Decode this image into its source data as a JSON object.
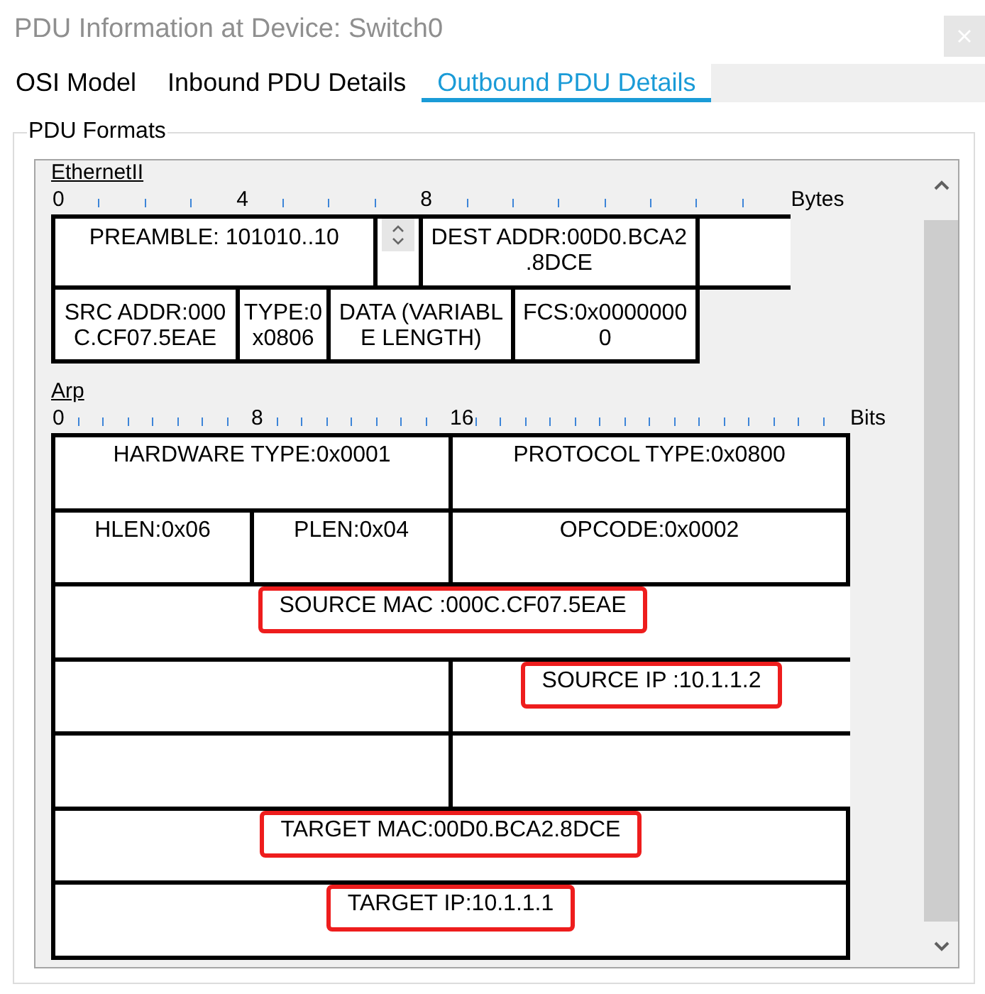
{
  "window": {
    "title": "PDU Information at Device: Switch0"
  },
  "tabs": [
    {
      "label": "OSI Model",
      "selected": false
    },
    {
      "label": "Inbound PDU Details",
      "selected": false
    },
    {
      "label": "Outbound PDU Details",
      "selected": true
    }
  ],
  "pdu_formats": {
    "title": "PDU Formats",
    "diagrams": [
      {
        "name": "EthernetII",
        "ruler": {
          "labels": [
            "0",
            "4",
            "8"
          ],
          "unit": "Bytes"
        },
        "rows": [
          [
            {
              "kind": "field",
              "text": "PREAMBLE: 101010..10",
              "colspan": 7,
              "highlighted": false
            },
            {
              "kind": "spinner",
              "highlighted": false
            },
            {
              "kind": "field",
              "text": "DEST ADDR:00D0.BCA2.8DCE",
              "colspan": 6,
              "highlighted": false
            },
            {
              "kind": "blank",
              "colspan": 2,
              "highlighted": false
            }
          ],
          [
            {
              "kind": "field",
              "text": "SRC ADDR:000C.CF07.5EAE",
              "colspan": 4,
              "highlighted": false
            },
            {
              "kind": "field",
              "text": "TYPE:0x0806",
              "colspan": 2,
              "highlighted": false
            },
            {
              "kind": "field",
              "text": "DATA (VARIABLE LENGTH)",
              "colspan": 4,
              "highlighted": false
            },
            {
              "kind": "field",
              "text": "FCS:0x00000000",
              "colspan": 4,
              "highlighted": false
            }
          ]
        ]
      },
      {
        "name": "Arp",
        "ruler": {
          "labels": [
            "0",
            "8",
            "16"
          ],
          "unit": "Bits"
        },
        "rows": [
          [
            {
              "kind": "field",
              "text": "HARDWARE TYPE:0x0001",
              "colspan": 16,
              "highlighted": false
            },
            {
              "kind": "field",
              "text": "PROTOCOL TYPE:0x0800",
              "colspan": 16,
              "highlighted": false
            }
          ],
          [
            {
              "kind": "field",
              "text": "HLEN:0x06",
              "colspan": 8,
              "highlighted": false
            },
            {
              "kind": "field",
              "text": "PLEN:0x04",
              "colspan": 8,
              "highlighted": false
            },
            {
              "kind": "field",
              "text": "OPCODE:0x0002",
              "colspan": 16,
              "highlighted": false
            }
          ],
          [
            {
              "kind": "field",
              "text": "SOURCE MAC :000C.CF07.5EAE",
              "colspan": 32,
              "highlighted": true
            }
          ],
          [
            {
              "kind": "blank",
              "colspan": 16,
              "highlighted": false
            },
            {
              "kind": "field",
              "text": "SOURCE IP :10.1.1.2",
              "colspan": 16,
              "highlighted": true
            }
          ],
          [
            {
              "kind": "blank",
              "colspan": 16,
              "highlighted": false
            },
            {
              "kind": "blank",
              "colspan": 16,
              "highlighted": false
            }
          ],
          [
            {
              "kind": "field",
              "text": "TARGET MAC:00D0.BCA2.8DCE",
              "colspan": 32,
              "highlighted": true
            }
          ],
          [
            {
              "kind": "field",
              "text": "TARGET IP:10.1.1.1",
              "colspan": 32,
              "highlighted": true
            }
          ]
        ]
      }
    ]
  }
}
